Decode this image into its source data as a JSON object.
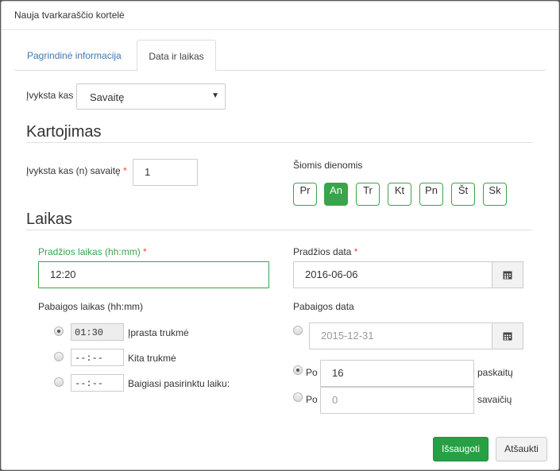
{
  "modal": {
    "title": "Nauja tvarkaraščio kortelė"
  },
  "tabs": [
    {
      "label": "Pagrindinė informacija",
      "active": false
    },
    {
      "label": "Data ir laikas",
      "active": true
    }
  ],
  "occurs": {
    "label": "Įvyksta kas",
    "value": "Savaitę"
  },
  "repeat": {
    "title": "Kartojimas",
    "every_label": "Įvyksta kas (n) savaitę",
    "every_value": "1",
    "days_label": "Šiomis dienomis",
    "days": [
      {
        "label": "Pr",
        "active": false
      },
      {
        "label": "An",
        "active": true
      },
      {
        "label": "Tr",
        "active": false
      },
      {
        "label": "Kt",
        "active": false
      },
      {
        "label": "Pn",
        "active": false
      },
      {
        "label": "Št",
        "active": false
      },
      {
        "label": "Sk",
        "active": false
      }
    ]
  },
  "time": {
    "title": "Laikas",
    "start_time_label": "Pradžios laikas (hh:mm)",
    "start_time_value": "12:20",
    "start_date_label": "Pradžios data",
    "start_date_value": "2016-06-06",
    "end_time_label": "Pabaigos laikas (hh:mm)",
    "end_date_label": "Pabaigos data",
    "end_time_options": [
      {
        "value": "01:30",
        "label": "Įprasta trukmė",
        "checked": true
      },
      {
        "value": "--:--",
        "label": "Kita trukmė",
        "checked": false
      },
      {
        "value": "--:--",
        "label": "Baigiasi pasirinktu laiku:",
        "checked": false
      }
    ],
    "end_date_value": "2015-12-31",
    "after_label": "Po",
    "after_occurrences_value": "16",
    "after_occurrences_unit": "paskaitų",
    "after_weeks_value": "0",
    "after_weeks_unit": "savaičių"
  },
  "actions": {
    "save": "Išsaugoti",
    "cancel": "Atšaukti"
  },
  "colors": {
    "accent": "#27a045",
    "link": "#3c79b5",
    "required": "#e74c3c"
  },
  "icons": {
    "calendar": "calendar-icon",
    "caret": "caret-down-icon"
  }
}
